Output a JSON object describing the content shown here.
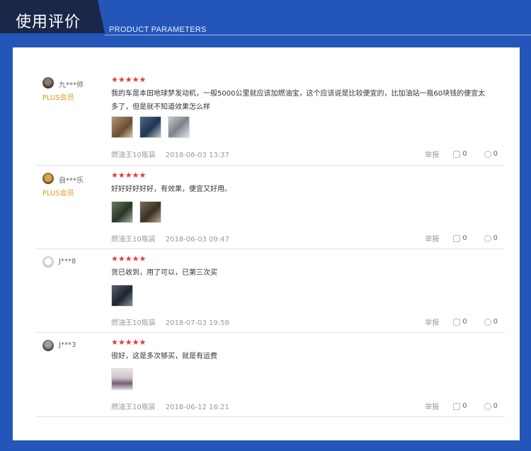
{
  "header": {
    "title": "使用评价",
    "subtitle": "PRODUCT PARAMETERS"
  },
  "reviews": [
    {
      "user": "九***师",
      "badge": "PLUS会员",
      "stars": "★★★★★",
      "text": "我的车是本田地球梦发动机，一般5000公里就应该加燃油宝，这个应该说是比较便宜的，比加油站一瓶60块钱的便宜太多了，但是就不知道效果怎么样",
      "product": "燃油王10瓶装",
      "date": "2018-06-03 13:37",
      "report": "举报",
      "likes": "0",
      "comments": "0",
      "thumb_colors": [
        "#8a6a4a",
        "#2f4f6f",
        "#9aa0a8"
      ]
    },
    {
      "user": "自***乐",
      "badge": "PLUS会员",
      "stars": "★★★★★",
      "text": "好好好好好好，有效果，便宜又好用。",
      "product": "燃油王10瓶装",
      "date": "2018-06-03 09:47",
      "report": "举报",
      "likes": "0",
      "comments": "0",
      "thumb_colors": [
        "#3b4a3a",
        "#5a5040"
      ]
    },
    {
      "user": "J***8",
      "badge": "",
      "stars": "★★★★★",
      "text": "货已收到，用了可以，已第三次买",
      "product": "燃油王10瓶装",
      "date": "2018-07-03 19:58",
      "report": "举报",
      "likes": "0",
      "comments": "0",
      "thumb_colors": [
        "#3a3f4a"
      ]
    },
    {
      "user": "J***3",
      "badge": "",
      "stars": "★★★★★",
      "text": "很好，这是多次够买，就是有运费",
      "product": "燃油王10瓶装",
      "date": "2018-06-12 16:21",
      "report": "举报",
      "likes": "0",
      "comments": "0",
      "thumb_colors": [
        "#c9c2c6"
      ]
    }
  ]
}
